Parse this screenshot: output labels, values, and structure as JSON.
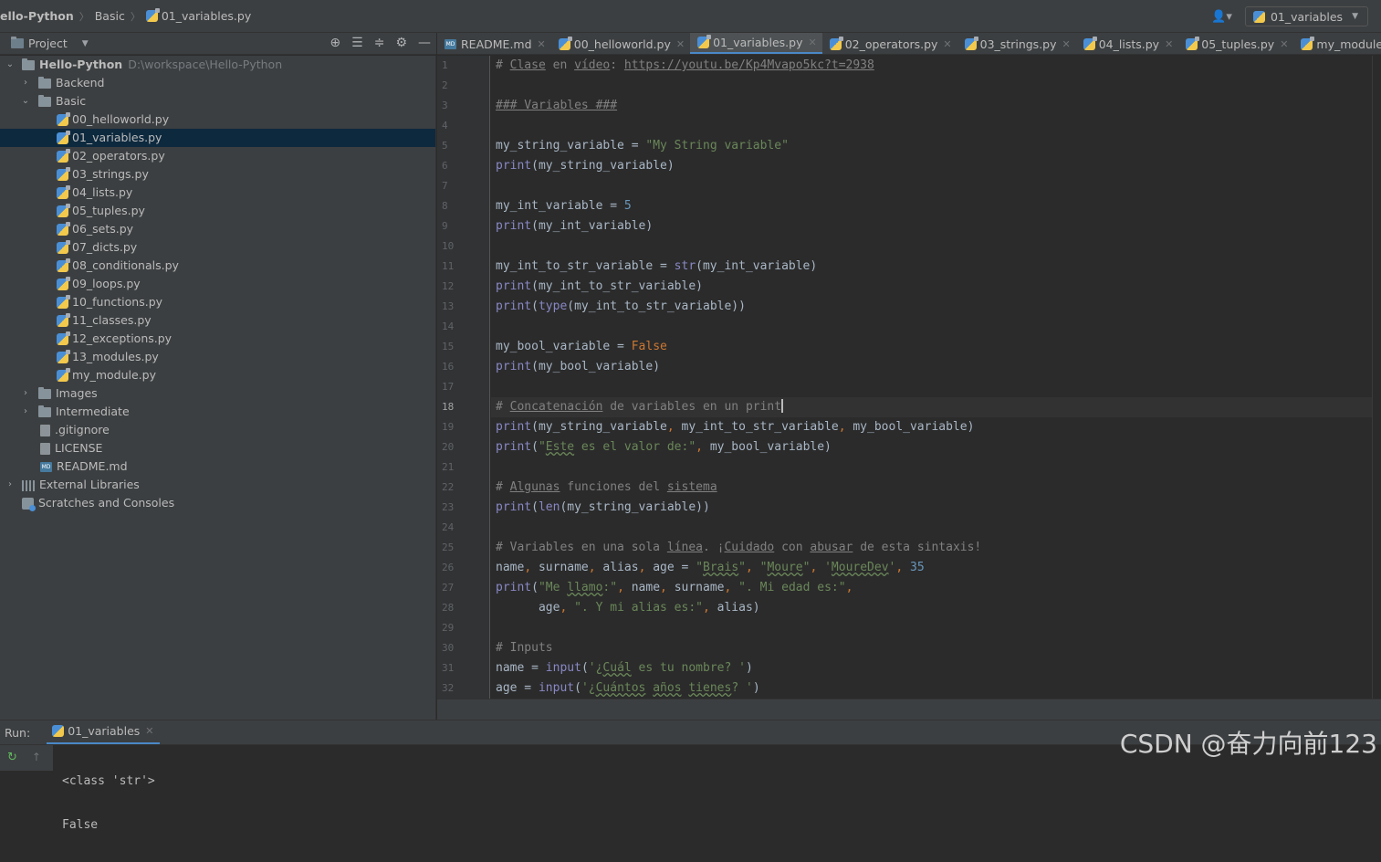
{
  "breadcrumb": {
    "project": "ello-Python",
    "folder": "Basic",
    "file": "01_variables.py"
  },
  "run_config": {
    "label": "01_variables"
  },
  "project_panel": {
    "title": "Project"
  },
  "tree": {
    "root": {
      "name": "Hello-Python",
      "path": "D:\\workspace\\Hello-Python"
    },
    "backend": "Backend",
    "basic": "Basic",
    "files": [
      "00_helloworld.py",
      "01_variables.py",
      "02_operators.py",
      "03_strings.py",
      "04_lists.py",
      "05_tuples.py",
      "06_sets.py",
      "07_dicts.py",
      "08_conditionals.py",
      "09_loops.py",
      "10_functions.py",
      "11_classes.py",
      "12_exceptions.py",
      "13_modules.py",
      "my_module.py"
    ],
    "images": "Images",
    "intermediate": "Intermediate",
    "gitignore": ".gitignore",
    "license": "LICENSE",
    "readme": "README.md",
    "external": "External Libraries",
    "scratches": "Scratches and Consoles"
  },
  "tabs": [
    "README.md",
    "00_helloworld.py",
    "01_variables.py",
    "02_operators.py",
    "03_strings.py",
    "04_lists.py",
    "05_tuples.py",
    "my_module.py"
  ],
  "line_numbers": [
    "1",
    "2",
    "3",
    "4",
    "5",
    "6",
    "7",
    "8",
    "9",
    "10",
    "11",
    "12",
    "13",
    "14",
    "15",
    "16",
    "17",
    "18",
    "19",
    "20",
    "21",
    "22",
    "23",
    "24",
    "25",
    "26",
    "27",
    "28",
    "29",
    "30",
    "31",
    "32"
  ],
  "run": {
    "label": "Run:",
    "tab": "01_variables",
    "output": [
      "<class 'str'>",
      "False"
    ]
  },
  "watermark": "CSDN @奋力向前123",
  "colors": {
    "accent": "#4a88c7",
    "selection": "#0d293e"
  }
}
